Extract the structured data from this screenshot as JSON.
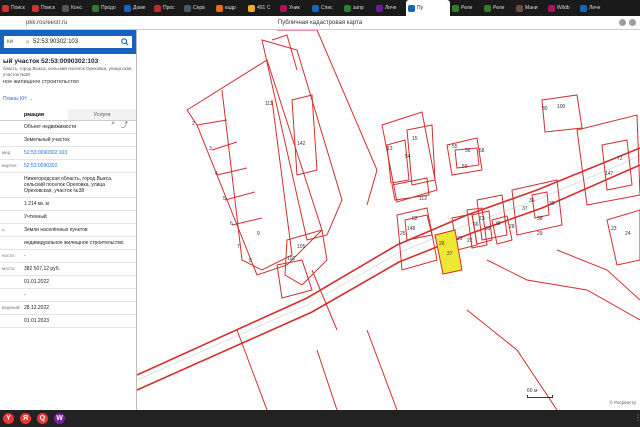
{
  "browser": {
    "tabs": [
      {
        "label": "Поиск",
        "color": "#d32f2f"
      },
      {
        "label": "Поиск",
        "color": "#d32f2f"
      },
      {
        "label": "Конс",
        "color": "#555"
      },
      {
        "label": "Продо",
        "color": "#2e7d32"
      },
      {
        "label": "Доме",
        "color": "#1565c0"
      },
      {
        "label": "Прос",
        "color": "#c62828"
      },
      {
        "label": "Серв",
        "color": "#455a64"
      },
      {
        "label": "кадр",
        "color": "#ef6c00"
      },
      {
        "label": "491 С",
        "color": "#f9a825"
      },
      {
        "label": "Уник",
        "color": "#ad1457"
      },
      {
        "label": "Спис",
        "color": "#1565c0"
      },
      {
        "label": "запр",
        "color": "#2e7d32"
      },
      {
        "label": "Личн",
        "color": "#6a1b9a"
      },
      {
        "label": "Пу",
        "color": "#1565c0",
        "active": true
      },
      {
        "label": "Реле",
        "color": "#2e7d32"
      },
      {
        "label": "Реле",
        "color": "#2e7d32"
      },
      {
        "label": "Мани",
        "color": "#6d4c41"
      },
      {
        "label": "Wildb",
        "color": "#ad1457"
      },
      {
        "label": "Личн",
        "color": "#1565c0"
      }
    ],
    "url": "pkk.rosreestr.ru",
    "page_title": "Публичная кадастровая карта"
  },
  "sidebar": {
    "search_mode": "ки",
    "search_value": "52:53:90302:103",
    "title": "ый участок 52:53:0090302:103",
    "address": "бласть, город Выкса, сельский поселок Ореховка, улица ская, участок №38",
    "usage": "ное жилищное строительство",
    "map_link": "Планы КН →",
    "tab_info": "рмация",
    "tab_services": "Услуги",
    "properties": [
      {
        "key": "",
        "value": "Объект недвижимости",
        "link": false
      },
      {
        "key": "",
        "value": "Земельный участок",
        "link": false
      },
      {
        "key": "мер:",
        "value": "52:53:0090302:103",
        "link": true
      },
      {
        "key": "вартал:",
        "value": "52:53:0090302",
        "link": true
      },
      {
        "key": "",
        "value": "Нижегородская область, город Выкса, сельский поселок Ореховка, улица Ореховская, участок №38",
        "link": false
      },
      {
        "key": "",
        "value": "1 214 кв. м",
        "link": false
      },
      {
        "key": "",
        "value": "Учтенный",
        "link": false
      },
      {
        "key": "ь:",
        "value": "Земли населённых пунктов",
        "link": false
      },
      {
        "key": "",
        "value": "индивидуальное жилищное строительство",
        "link": false
      },
      {
        "key": "ности:",
        "value": "-",
        "link": false
      },
      {
        "key": "мость:",
        "value": "382 507,12 руб.",
        "link": false
      },
      {
        "key": "",
        "value": "01.01.2022",
        "link": false
      },
      {
        "key": "",
        "value": "-",
        "link": false
      },
      {
        "key": "ведений:",
        "value": "28.12.2022",
        "link": false
      },
      {
        "key": "",
        "value": "01.01.2023",
        "link": false
      }
    ]
  },
  "map": {
    "parcel_labels": [
      "2",
      "3",
      "4",
      "5",
      "6",
      "7",
      "8",
      "9",
      "13",
      "15",
      "54",
      "55",
      "56",
      "58",
      "59",
      "72",
      "80",
      "100",
      "102",
      "105",
      "111",
      "142",
      "147",
      "148",
      "112",
      "52",
      "73",
      "38",
      "37",
      "36",
      "38",
      "39",
      "66",
      "21",
      "22",
      "23",
      "24",
      "25",
      "26",
      "27",
      "28",
      "29",
      "30"
    ],
    "scale_label": "60 м",
    "copyright": "© Росреестр",
    "highlight_color": "#f0e634",
    "boundary_color": "#d32f2f"
  },
  "taskbar": {
    "apps": [
      {
        "name": "yandex-browser",
        "color": "#e53935",
        "glyph": "Y"
      },
      {
        "name": "yandex",
        "color": "#e53935",
        "glyph": "Я"
      },
      {
        "name": "search",
        "color": "#e53935",
        "glyph": "Q"
      },
      {
        "name": "messenger",
        "color": "#7b1fa2",
        "glyph": "W"
      }
    ]
  }
}
